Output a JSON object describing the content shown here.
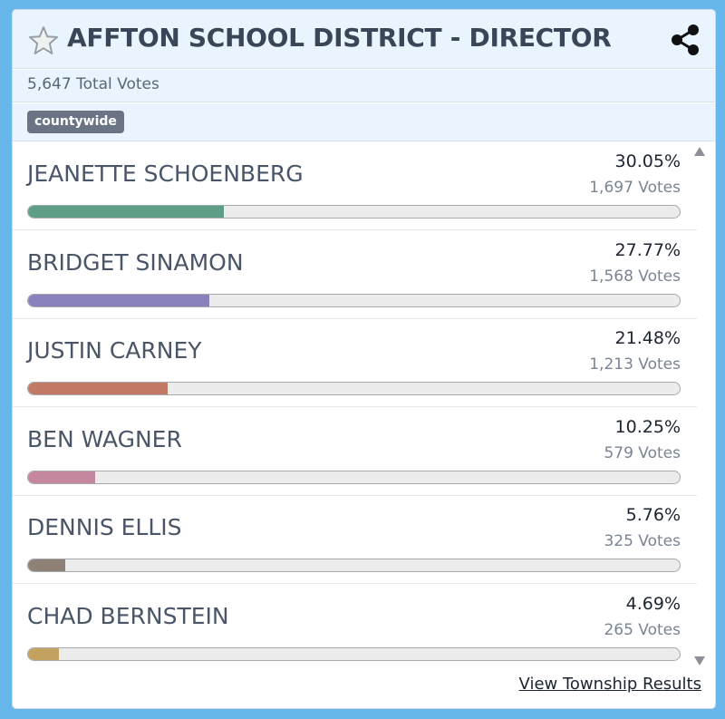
{
  "header": {
    "title": "AFFTON SCHOOL DISTRICT - DIRECTOR",
    "favorite_icon": "star-icon",
    "share_icon": "share-icon"
  },
  "summary": {
    "total_votes": "5,647 Total Votes",
    "tag": "countywide"
  },
  "candidates": [
    {
      "name": "JEANETTE SCHOENBERG",
      "percent": "30.05%",
      "votes": "1,697 Votes",
      "share": 30.05,
      "color": "#5e9e87"
    },
    {
      "name": "BRIDGET SINAMON",
      "percent": "27.77%",
      "votes": "1,568 Votes",
      "share": 27.77,
      "color": "#8a82bd"
    },
    {
      "name": "JUSTIN CARNEY",
      "percent": "21.48%",
      "votes": "1,213 Votes",
      "share": 21.48,
      "color": "#c27a66"
    },
    {
      "name": "BEN WAGNER",
      "percent": "10.25%",
      "votes": "579 Votes",
      "share": 10.25,
      "color": "#c587a0"
    },
    {
      "name": "DENNIS ELLIS",
      "percent": "5.76%",
      "votes": "325 Votes",
      "share": 5.76,
      "color": "#8d8275"
    },
    {
      "name": "CHAD BERNSTEIN",
      "percent": "4.69%",
      "votes": "265 Votes",
      "share": 4.69,
      "color": "#c2a25e"
    }
  ],
  "footer": {
    "link_label": "View Township Results"
  },
  "colors": {
    "page_background": "#67b7ea",
    "header_background": "#eaf4fe",
    "tag_background": "#6a7484"
  }
}
